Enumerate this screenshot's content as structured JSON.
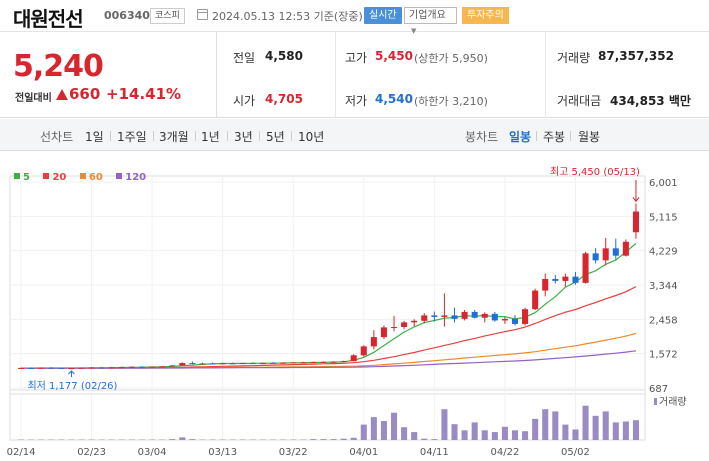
{
  "header": {
    "stock_name": "대원전선",
    "stock_code": "006340",
    "market": "코스피",
    "timestamp": "2024.05.13 12:53 기준(장중)",
    "realtime_label": "실시간",
    "company_label": "기업개요",
    "warning_label": "투자주의"
  },
  "price": {
    "current": "5,240",
    "change_label": "전일대비",
    "change_value": "660",
    "change_rate": "+14.41%"
  },
  "stats": {
    "prev_close_label": "전일",
    "prev_close": "4,580",
    "open_label": "시가",
    "open": "4,705",
    "high_label": "고가",
    "high": "5,450",
    "upper_limit": "(상한가 5,950)",
    "low_label": "저가",
    "low": "4,540",
    "lower_limit": "(하한가 3,210)",
    "volume_label": "거래량",
    "volume": "87,357,352",
    "amount_label": "거래대금",
    "amount": "434,853 백만"
  },
  "tabs": {
    "line_label": "선차트",
    "periods": [
      "1일",
      "1주일",
      "3개월",
      "1년",
      "3년",
      "5년",
      "10년"
    ],
    "candle_label": "봉차트",
    "candles": [
      "일봉",
      "주봉",
      "월봉"
    ],
    "active_candle": "일봉"
  },
  "legend": [
    {
      "label": "5",
      "color": "#3cb043"
    },
    {
      "label": "20",
      "color": "#e8413c"
    },
    {
      "label": "60",
      "color": "#f0892b"
    },
    {
      "label": "120",
      "color": "#9461c6"
    }
  ],
  "chart_data": {
    "type": "candlestick",
    "y_ticks": [
      "6,001",
      "5,115",
      "4,229",
      "3,344",
      "2,458",
      "1,572",
      "687"
    ],
    "ylim": [
      687,
      6001
    ],
    "x_ticks": [
      "02/14",
      "02/23",
      "03/04",
      "03/13",
      "03/22",
      "04/01",
      "04/11",
      "04/22",
      "05/02"
    ],
    "high_annotation": "최고 5,450 (05/13)",
    "low_annotation": "최저 1,177 (02/26)",
    "volume_label": "거래량",
    "up_color": "#d8262f",
    "down_color": "#1f6fd6",
    "candles": [
      [
        1200,
        1215,
        1190,
        1205
      ],
      [
        1205,
        1220,
        1195,
        1200
      ],
      [
        1200,
        1215,
        1190,
        1210
      ],
      [
        1210,
        1225,
        1195,
        1205
      ],
      [
        1205,
        1215,
        1185,
        1195
      ],
      [
        1195,
        1210,
        1177,
        1200
      ],
      [
        1200,
        1220,
        1190,
        1210
      ],
      [
        1210,
        1225,
        1200,
        1215
      ],
      [
        1215,
        1230,
        1200,
        1210
      ],
      [
        1210,
        1225,
        1200,
        1220
      ],
      [
        1220,
        1240,
        1210,
        1225
      ],
      [
        1225,
        1245,
        1215,
        1235
      ],
      [
        1235,
        1250,
        1220,
        1230
      ],
      [
        1230,
        1245,
        1220,
        1240
      ],
      [
        1240,
        1260,
        1230,
        1245
      ],
      [
        1245,
        1280,
        1240,
        1270
      ],
      [
        1270,
        1350,
        1260,
        1330
      ],
      [
        1330,
        1370,
        1300,
        1310
      ],
      [
        1310,
        1340,
        1290,
        1320
      ],
      [
        1320,
        1345,
        1305,
        1315
      ],
      [
        1315,
        1340,
        1300,
        1325
      ],
      [
        1325,
        1345,
        1310,
        1320
      ],
      [
        1320,
        1340,
        1305,
        1330
      ],
      [
        1330,
        1350,
        1315,
        1325
      ],
      [
        1325,
        1345,
        1310,
        1335
      ],
      [
        1335,
        1355,
        1320,
        1330
      ],
      [
        1330,
        1350,
        1315,
        1340
      ],
      [
        1340,
        1360,
        1325,
        1345
      ],
      [
        1345,
        1365,
        1330,
        1350
      ],
      [
        1350,
        1370,
        1335,
        1355
      ],
      [
        1355,
        1375,
        1340,
        1360
      ],
      [
        1360,
        1380,
        1345,
        1365
      ],
      [
        1365,
        1390,
        1350,
        1380
      ],
      [
        1380,
        1560,
        1370,
        1530
      ],
      [
        1530,
        1790,
        1500,
        1760
      ],
      [
        1760,
        2180,
        1680,
        2000
      ],
      [
        2000,
        2300,
        1950,
        2250
      ],
      [
        2250,
        2550,
        2150,
        2260
      ],
      [
        2260,
        2420,
        2200,
        2380
      ],
      [
        2380,
        2460,
        2280,
        2420
      ],
      [
        2420,
        2620,
        2350,
        2560
      ],
      [
        2560,
        2660,
        2400,
        2520
      ],
      [
        2520,
        3130,
        2270,
        2560
      ],
      [
        2560,
        2760,
        2380,
        2470
      ],
      [
        2470,
        2700,
        2430,
        2650
      ],
      [
        2650,
        2700,
        2480,
        2500
      ],
      [
        2500,
        2640,
        2380,
        2600
      ],
      [
        2600,
        2650,
        2400,
        2430
      ],
      [
        2430,
        2520,
        2340,
        2470
      ],
      [
        2470,
        2570,
        2300,
        2340
      ],
      [
        2340,
        2760,
        2300,
        2720
      ],
      [
        2720,
        3250,
        2700,
        3200
      ],
      [
        3200,
        3640,
        3050,
        3500
      ],
      [
        3500,
        3600,
        3380,
        3450
      ],
      [
        3450,
        3640,
        3300,
        3560
      ],
      [
        3560,
        3680,
        3350,
        3400
      ],
      [
        3400,
        4200,
        3380,
        4160
      ],
      [
        4160,
        4300,
        3900,
        3980
      ],
      [
        3980,
        4560,
        3850,
        4290
      ],
      [
        4290,
        4540,
        4000,
        4100
      ],
      [
        4100,
        4520,
        4080,
        4460
      ],
      [
        4705,
        5450,
        4540,
        5240
      ]
    ],
    "volume": [
      1,
      1,
      1,
      1,
      1,
      1,
      1,
      1,
      1,
      1,
      1,
      1,
      1,
      1,
      1,
      2,
      6,
      2,
      1,
      1,
      1,
      1,
      1,
      1,
      1,
      1,
      1,
      1,
      1,
      2,
      2,
      2,
      3,
      5,
      35,
      52,
      43,
      62,
      29,
      18,
      3,
      2,
      70,
      36,
      22,
      40,
      22,
      18,
      30,
      22,
      20,
      48,
      70,
      65,
      35,
      24,
      78,
      55,
      65,
      40,
      42,
      45
    ],
    "volume_max": 100
  }
}
